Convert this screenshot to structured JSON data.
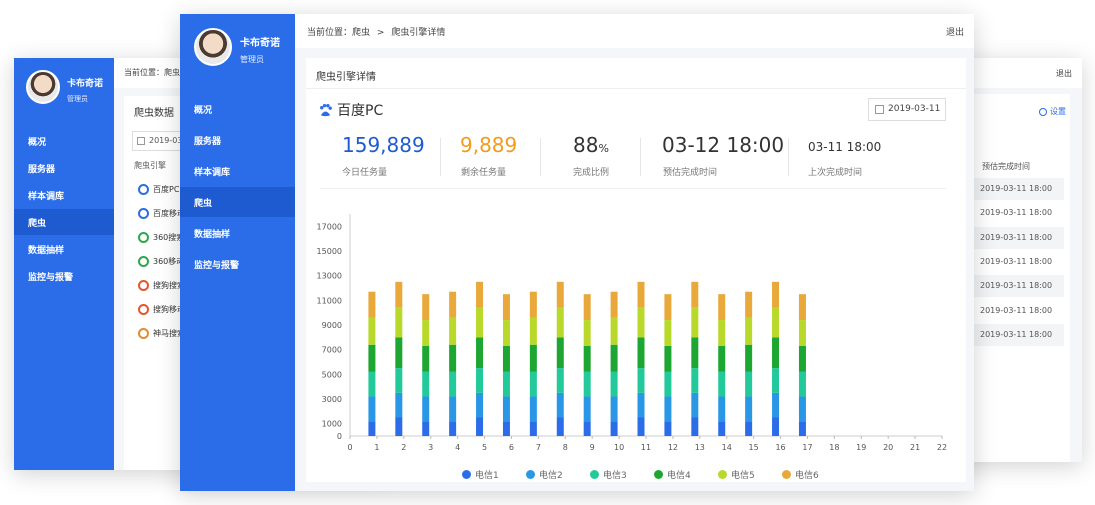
{
  "user": {
    "name": "卡布奇诺",
    "role": "管理员"
  },
  "menu": [
    "概况",
    "服务器",
    "样本调库",
    "爬虫",
    "数据抽样",
    "监控与报警"
  ],
  "menu_active_index": 3,
  "back_left": {
    "breadcrumb": "当前位置：爬虫",
    "card_title": "爬虫数据",
    "date": "2019-03-1",
    "list_header": "爬虫引擎",
    "engines": [
      {
        "name": "百度PC",
        "icon": "baidu-paw-icon",
        "color": "#2b6de8"
      },
      {
        "name": "百度移动",
        "icon": "baidu-paw-icon",
        "color": "#2b6de8"
      },
      {
        "name": "360搜索",
        "icon": "360-icon",
        "color": "#2aa84a"
      },
      {
        "name": "360移动",
        "icon": "360-icon",
        "color": "#2aa84a"
      },
      {
        "name": "搜狗搜索",
        "icon": "sogou-icon",
        "color": "#e8552b"
      },
      {
        "name": "搜狗移动",
        "icon": "sogou-icon",
        "color": "#e8552b"
      },
      {
        "name": "神马搜索",
        "icon": "shenma-icon",
        "color": "#e88a2b"
      }
    ]
  },
  "back_right": {
    "logout": "退出",
    "settings_label": "设置",
    "col_header": "预估完成时间",
    "times": [
      "2019-03-11 18:00",
      "2019-03-11 18:00",
      "2019-03-11 18:00",
      "2019-03-11 18:00",
      "2019-03-11 18:00",
      "2019-03-11 18:00",
      "2019-03-11 18:00"
    ]
  },
  "front": {
    "breadcrumb": {
      "prefix": "当前位置：",
      "parent": "爬虫",
      "sep": ">",
      "current": "爬虫引擎详情"
    },
    "logout": "退出",
    "card_title": "爬虫引擎详情",
    "engine_name": "百度PC",
    "date": "2019-03-11",
    "stats": [
      {
        "value": "159,889",
        "label": "今日任务量",
        "color": "#1f5bd0"
      },
      {
        "value": "9,889",
        "label": "剩余任务量",
        "color": "#f29b1d"
      },
      {
        "value": "88",
        "unit": "%",
        "label": "完成比例",
        "color": "#333333"
      },
      {
        "value": "03-12 18:00",
        "label": "预估完成时间",
        "color": "#333333"
      },
      {
        "value": "03-11 18:00",
        "label": "上次完成时间",
        "color": "#333333"
      }
    ]
  },
  "chart_data": {
    "type": "bar",
    "stacked": true,
    "x": [
      1,
      2,
      3,
      4,
      5,
      6,
      7,
      8,
      9,
      10,
      11,
      12,
      13,
      14,
      15,
      16,
      17
    ],
    "x_ticks": [
      0,
      1,
      2,
      3,
      4,
      5,
      6,
      7,
      8,
      9,
      10,
      11,
      12,
      13,
      14,
      15,
      16,
      17,
      18,
      19,
      20,
      21,
      22
    ],
    "y_ticks": [
      0,
      1000,
      3000,
      5000,
      7000,
      9000,
      11000,
      13000,
      15000,
      17000
    ],
    "ylim": [
      0,
      18000
    ],
    "xlim": [
      0,
      22
    ],
    "series": [
      {
        "name": "电信1",
        "color": "#2b6de8",
        "values": [
          1200,
          1500,
          1200,
          1200,
          1500,
          1200,
          1200,
          1500,
          1200,
          1200,
          1500,
          1200,
          1500,
          1200,
          1200,
          1500,
          1200
        ]
      },
      {
        "name": "电信2",
        "color": "#2a97e6",
        "values": [
          2000,
          2000,
          2000,
          2000,
          2000,
          2000,
          2000,
          2000,
          2000,
          2000,
          2000,
          2000,
          2000,
          2000,
          2000,
          2000,
          2000
        ]
      },
      {
        "name": "电信3",
        "color": "#22c99a",
        "values": [
          2000,
          2000,
          2000,
          2000,
          2000,
          2000,
          2000,
          2000,
          2000,
          2000,
          2000,
          2000,
          2000,
          2000,
          2000,
          2000,
          2000
        ]
      },
      {
        "name": "电信4",
        "color": "#1ea632",
        "values": [
          2200,
          2500,
          2100,
          2200,
          2500,
          2100,
          2200,
          2500,
          2100,
          2200,
          2500,
          2100,
          2500,
          2100,
          2200,
          2500,
          2100
        ]
      },
      {
        "name": "电信5",
        "color": "#b9d92a",
        "values": [
          2200,
          2400,
          2100,
          2200,
          2400,
          2100,
          2200,
          2400,
          2100,
          2200,
          2400,
          2100,
          2400,
          2100,
          2200,
          2400,
          2100
        ]
      },
      {
        "name": "电信6",
        "color": "#e8a93a",
        "values": [
          2100,
          2100,
          2100,
          2100,
          2100,
          2100,
          2100,
          2100,
          2100,
          2100,
          2100,
          2100,
          2100,
          2100,
          2100,
          2100,
          2100
        ]
      }
    ]
  }
}
